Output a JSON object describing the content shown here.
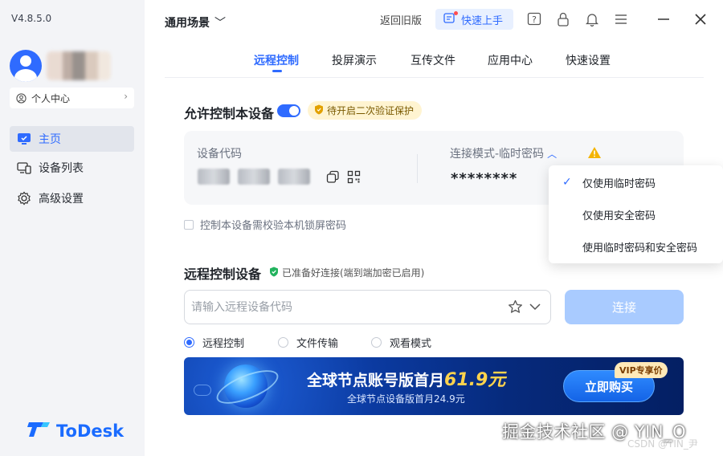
{
  "app": {
    "version": "V4.8.5.0",
    "brand": "ToDesk"
  },
  "sidebar": {
    "user_center": "个人中心",
    "items": [
      {
        "label": "主页",
        "icon": "monitor-icon",
        "active": true
      },
      {
        "label": "设备列表",
        "icon": "devices-icon",
        "active": false
      },
      {
        "label": "高级设置",
        "icon": "gear-icon",
        "active": false
      }
    ]
  },
  "topbar": {
    "scene": "通用场景",
    "legacy": "返回旧版",
    "quick_start": "快速上手",
    "icons": [
      "help-icon",
      "lock-icon",
      "bell-icon",
      "menu-icon",
      "minimize-icon",
      "close-icon"
    ]
  },
  "tabs": [
    "远程控制",
    "投屏演示",
    "互传文件",
    "应用中心",
    "快速设置"
  ],
  "allow": {
    "title": "允许控制本设备",
    "badge": "待开启二次验证保护",
    "device_code_label": "设备代码",
    "mode_label": "连接模式-临时密码",
    "password": "********",
    "lock_check": "控制本设备需校验本机锁屏密码"
  },
  "dropdown": {
    "items": [
      {
        "label": "仅使用临时密码",
        "checked": true
      },
      {
        "label": "仅使用安全密码",
        "checked": false
      },
      {
        "label": "使用临时密码和安全密码",
        "checked": false
      }
    ]
  },
  "remote": {
    "title": "远程控制设备",
    "ready": "已准备好连接(端到端加密已启用)",
    "placeholder": "请输入远程设备代码",
    "connect": "连接",
    "modes": [
      {
        "label": "远程控制",
        "checked": true
      },
      {
        "label": "文件传输",
        "checked": false
      },
      {
        "label": "观看模式",
        "checked": false
      }
    ]
  },
  "banner": {
    "title_prefix": "全球节点账号版首月",
    "price": "61.9元",
    "subtitle": "全球节点设备版首月24.9元",
    "buy": "立即购买",
    "vip": "VIP专享价"
  },
  "watermark": {
    "main": "掘金技术社区 @ YIN_O",
    "csdn": "CSDN @YIN_尹"
  },
  "colors": {
    "accent": "#2f6bff",
    "sidebar_bg": "#f3f4f7",
    "connect_disabled": "#a9cbff",
    "badge_bg": "#fff4d1",
    "price": "#ffd34d"
  }
}
